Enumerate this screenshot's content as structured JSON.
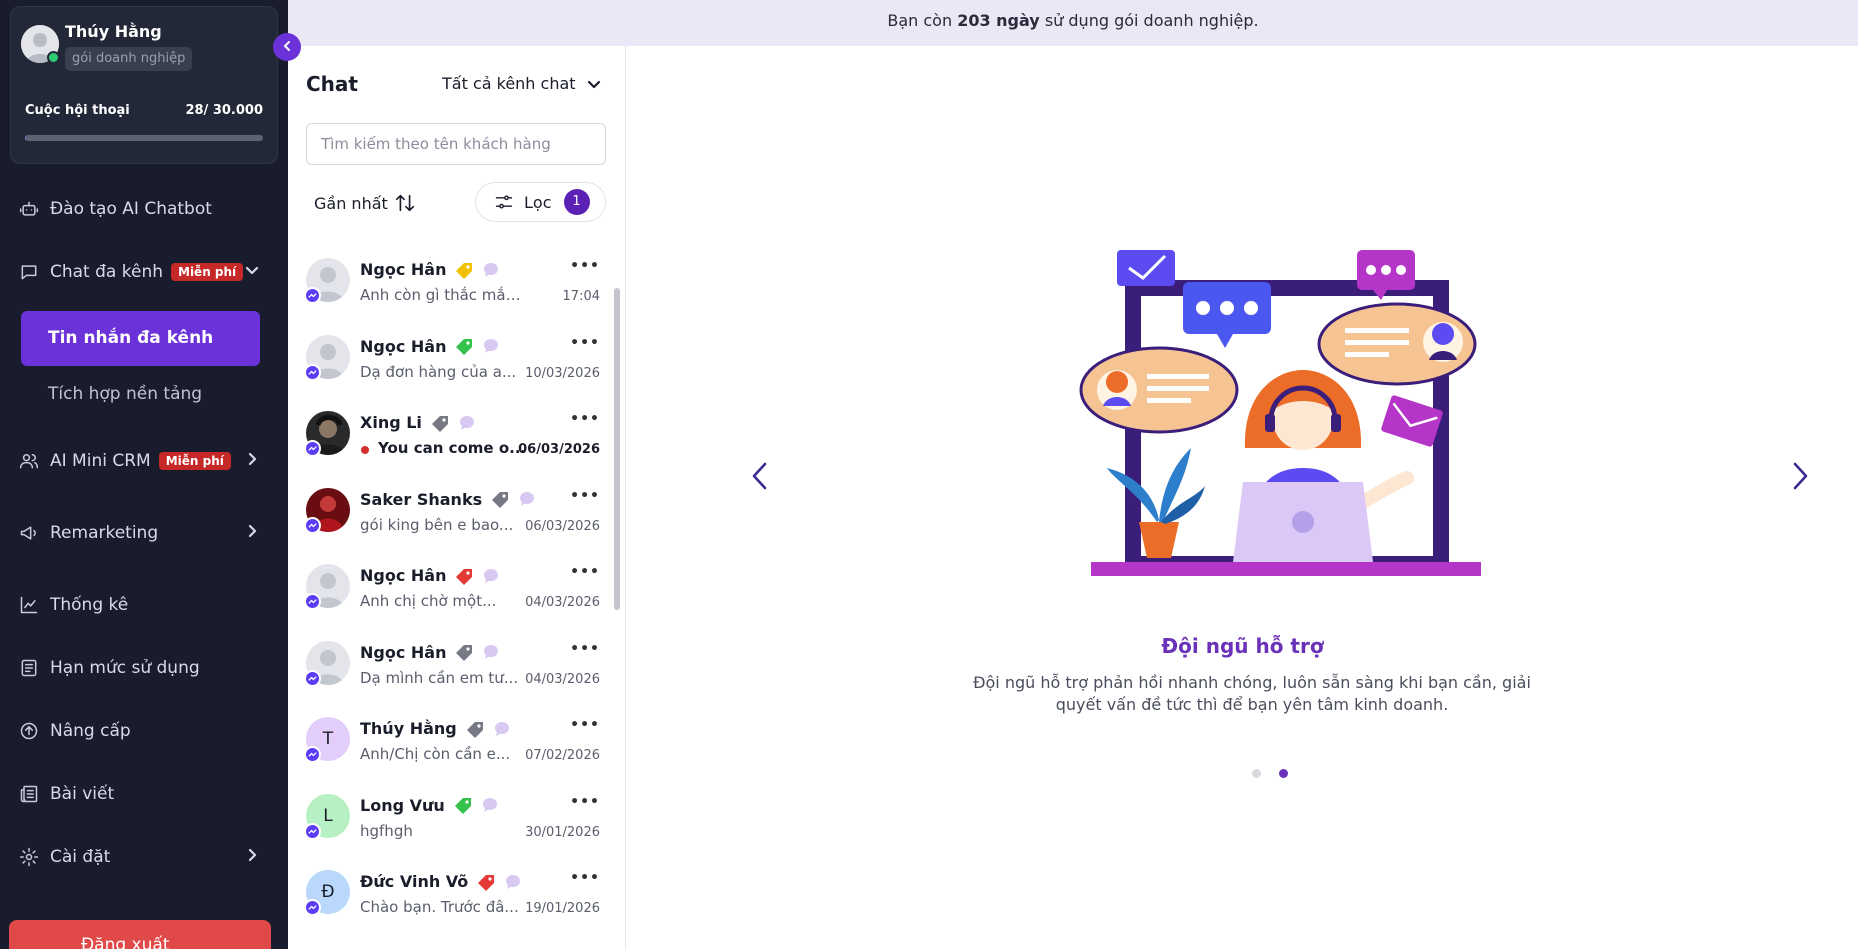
{
  "banner": {
    "prefix": "Bạn còn",
    "days": "203 ngày",
    "suffix": "sử dụng gói doanh nghiệp."
  },
  "profile": {
    "name": "Thúy Hằng",
    "plan": "gói doanh nghiệp",
    "quota_label": "Cuộc hội thoại",
    "quota_value": "28/ 30.000",
    "quota_used_fraction": 0.00093
  },
  "sidebar": {
    "items": [
      {
        "label": "Đào tạo AI Chatbot",
        "icon": "robot-icon"
      },
      {
        "label": "Chat đa kênh",
        "icon": "chat-icon",
        "badge": "Miễn phí",
        "expanded": true
      },
      {
        "label": "AI Mini CRM",
        "icon": "users-icon",
        "badge": "Miễn phí"
      },
      {
        "label": "Remarketing",
        "icon": "megaphone-icon"
      },
      {
        "label": "Thống kê",
        "icon": "chart-icon"
      },
      {
        "label": "Hạn mức sử dụng",
        "icon": "receipt-icon"
      },
      {
        "label": "Nâng cấp",
        "icon": "upgrade-icon"
      },
      {
        "label": "Bài viết",
        "icon": "newspaper-icon"
      },
      {
        "label": "Cài đặt",
        "icon": "gear-icon"
      }
    ],
    "subitems": [
      {
        "label": "Tin nhắn đa kênh",
        "active": true
      },
      {
        "label": "Tích hợp nền tảng",
        "active": false
      }
    ],
    "logout_label": "Đăng xuất"
  },
  "chat": {
    "title": "Chat",
    "channel_filter": "Tất cả kênh chat",
    "search_placeholder": "Tìm kiếm theo tên khách hàng",
    "sort_label": "Gần nhất",
    "filter_label": "Lọc",
    "filter_count": "1",
    "conversations": [
      {
        "name": "Ngọc Hân",
        "preview": "Anh còn gì thắc mắc...",
        "time": "17:04",
        "tag_color": "#f2c200",
        "avatar": "default",
        "unread": false
      },
      {
        "name": "Ngọc Hân",
        "preview": "Dạ đơn hàng của a...",
        "time": "10/03/2026",
        "tag_color": "#35c24a",
        "avatar": "default",
        "unread": false
      },
      {
        "name": "Xing Li",
        "preview": "You can come o...",
        "time": "06/03/2026",
        "tag_color": "#777a85",
        "avatar": "photo-dark",
        "unread": true
      },
      {
        "name": "Saker Shanks",
        "preview": "gói king bên e bao...",
        "time": "06/03/2026",
        "tag_color": "#777a85",
        "avatar": "photo-red",
        "unread": false
      },
      {
        "name": "Ngọc Hân",
        "preview": "Anh chị chờ một...",
        "time": "04/03/2026",
        "tag_color": "#e53935",
        "avatar": "default",
        "unread": false
      },
      {
        "name": "Ngọc Hân",
        "preview": "Dạ mình cần em tư...",
        "time": "04/03/2026",
        "tag_color": "#777a85",
        "avatar": "default",
        "unread": false
      },
      {
        "name": "Thúy Hằng",
        "preview": "Anh/Chị còn cần e...",
        "time": "07/02/2026",
        "tag_color": "#777a85",
        "avatar": "T",
        "avatar_bg": "#e2cdfb",
        "unread": false
      },
      {
        "name": "Long Vưu",
        "preview": "hgfhgh",
        "time": "30/01/2026",
        "tag_color": "#35c24a",
        "avatar": "L",
        "avatar_bg": "#b6f0c4",
        "unread": false
      },
      {
        "name": "Đức Vinh Võ",
        "preview": "Chào bạn. Trước đâ...",
        "time": "19/01/2026",
        "tag_color": "#e53935",
        "avatar": "Đ",
        "avatar_bg": "#b9d8fb",
        "unread": false
      }
    ]
  },
  "carousel": {
    "title": "Đội ngũ hỗ trợ",
    "description": "Đội ngũ hỗ trợ phản hồi nhanh chóng, luôn sẵn sàng khi bạn cần, giải quyết vấn đề tức thì để bạn yên tâm kinh doanh.",
    "active_index": 1,
    "dot_count": 2
  },
  "colors": {
    "sidebar_bg": "#181c2d",
    "accent": "#6a32d8",
    "badge_red": "#c62828",
    "banner_bg": "#ece7f6"
  }
}
